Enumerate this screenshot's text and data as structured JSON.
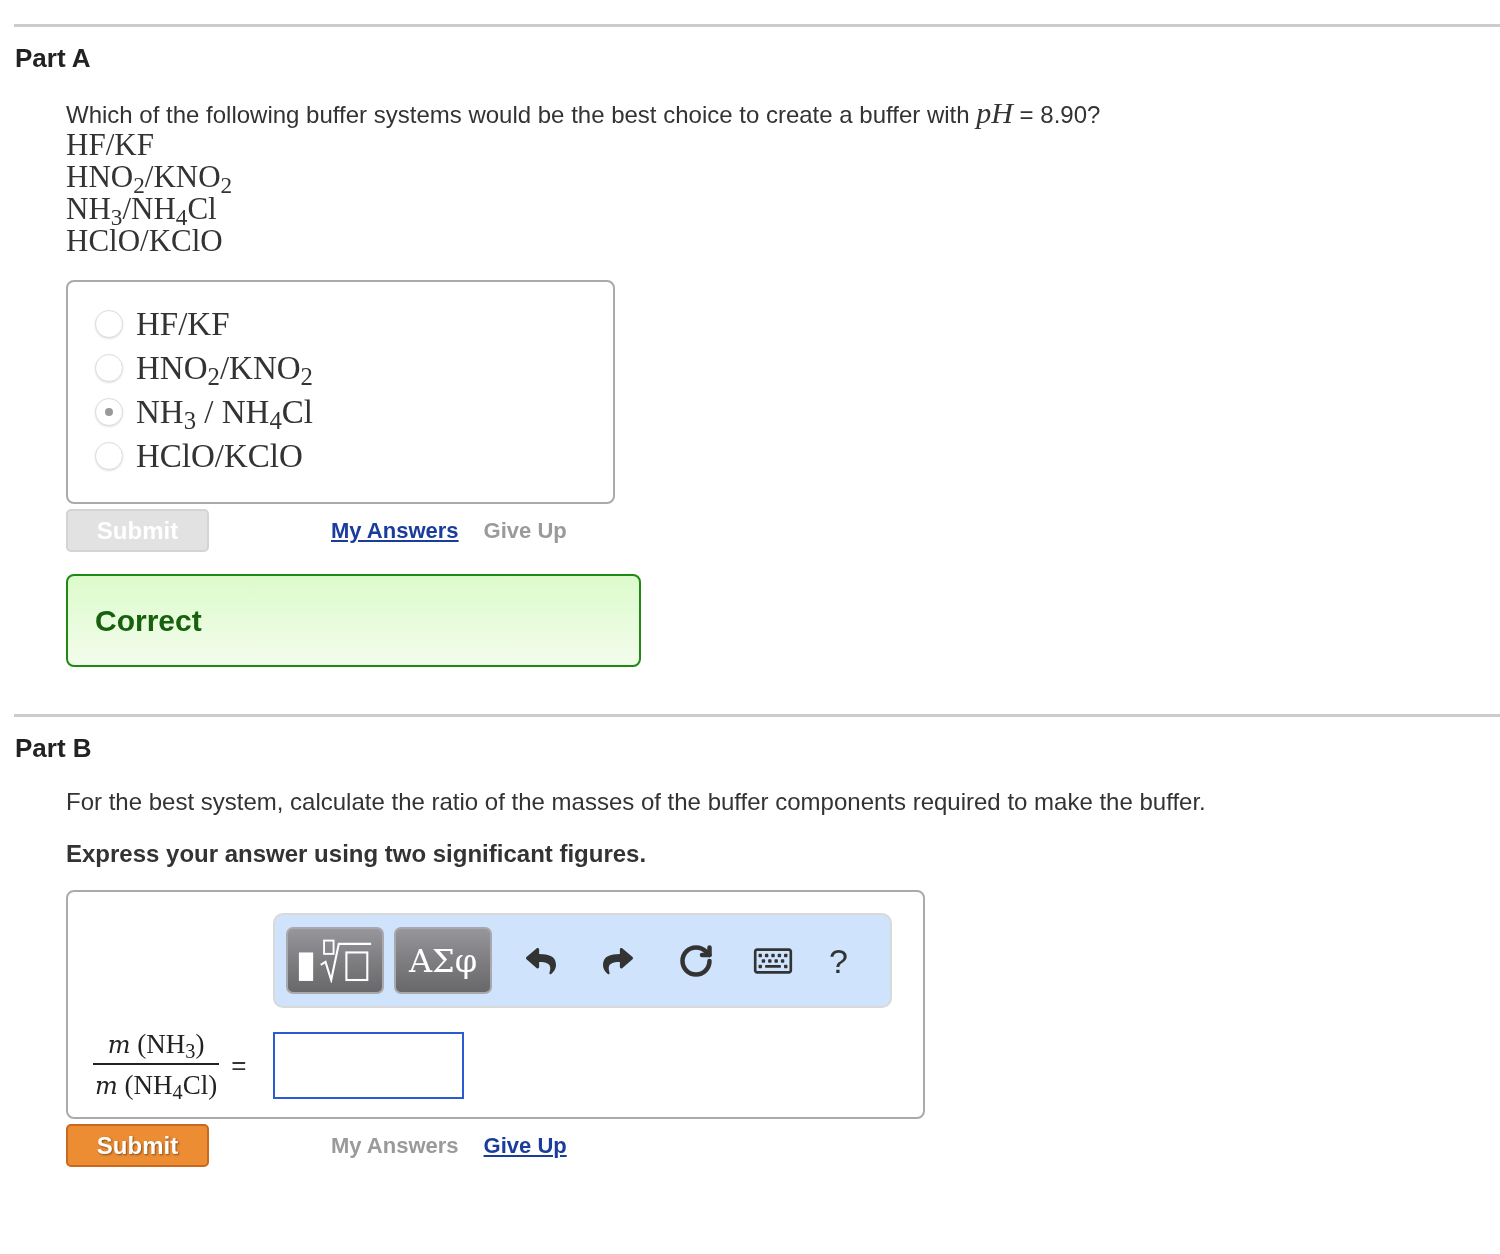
{
  "part_a": {
    "title": "Part A",
    "question": "Which of the following buffer systems would be the best choice to create a buffer with *pH* = 8.90?",
    "listed_systems": [
      "HF/KF",
      "HNO$_{2}$/KNO$_{2}$",
      "NH$_{3}$/NH$_{4}$Cl",
      "HClO/KClO"
    ],
    "options": [
      {
        "label": "HF/KF",
        "selected": false
      },
      {
        "label": "HNO$_{2}$/KNO$_{2}$",
        "selected": false
      },
      {
        "label": "NH$_{3}$ / NH$_{4}$Cl",
        "selected": true
      },
      {
        "label": "HClO/KClO",
        "selected": false
      }
    ],
    "submit": {
      "label": "Submit",
      "disabled": true
    },
    "links": [
      {
        "label": "My Answers",
        "disabled": false
      },
      {
        "label": "Give Up",
        "disabled": true
      }
    ],
    "feedback": {
      "kind": "correct",
      "text": "Correct"
    }
  },
  "part_b": {
    "title": "Part B",
    "question": "For the best system, calculate the ratio of the masses of the buffer components required to make the buffer.",
    "instruction": "Express your answer using two significant figures.",
    "toolbar": {
      "symbols_label": "ΑΣφ",
      "help_label": "?"
    },
    "answer": {
      "numerator": "*m* (NH$_{3}$)",
      "denominator": "*m* (NH$_{4}$Cl)",
      "equals": "="
    },
    "submit": {
      "label": "Submit",
      "disabled": false
    },
    "links": [
      {
        "label": "My Answers",
        "disabled": true
      },
      {
        "label": "Give Up",
        "disabled": false
      }
    ]
  }
}
